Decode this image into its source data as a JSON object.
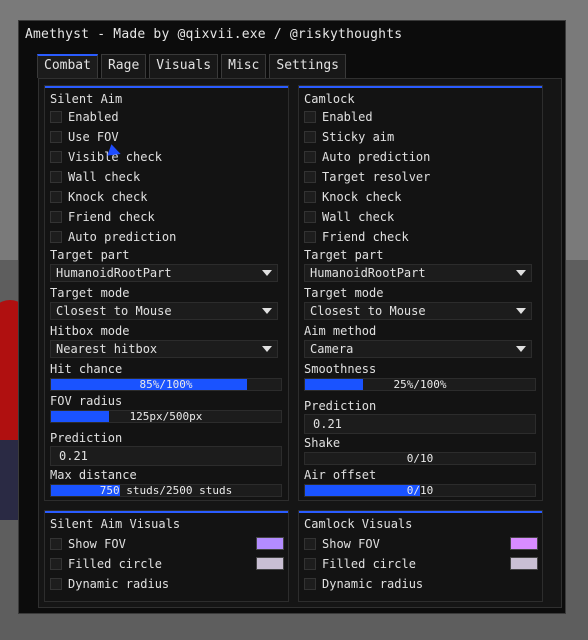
{
  "window": {
    "title": "Amethyst - Made by @qixvii.exe / @riskythoughts"
  },
  "tabs": [
    "Combat",
    "Rage",
    "Visuals",
    "Misc",
    "Settings"
  ],
  "active_tab": "Combat",
  "accent_color": "#2a5cff",
  "silent_aim": {
    "title": "Silent Aim",
    "checkboxes": [
      "Enabled",
      "Use FOV",
      "Visible check",
      "Wall check",
      "Knock check",
      "Friend check",
      "Auto prediction"
    ],
    "target_part": {
      "label": "Target part",
      "value": "HumanoidRootPart"
    },
    "target_mode": {
      "label": "Target mode",
      "value": "Closest to Mouse"
    },
    "hitbox_mode": {
      "label": "Hitbox mode",
      "value": "Nearest hitbox"
    },
    "hit_chance": {
      "label": "Hit chance",
      "text": "85%/100%",
      "fraction": 0.85
    },
    "fov_radius": {
      "label": "FOV radius",
      "text": "125px/500px",
      "fraction": 0.25
    },
    "prediction": {
      "label": "Prediction",
      "value": "0.21"
    },
    "max_distance": {
      "label": "Max distance",
      "text": "750 studs/2500 studs",
      "fraction": 0.3
    }
  },
  "camlock": {
    "title": "Camlock",
    "checkboxes": [
      "Enabled",
      "Sticky aim",
      "Auto prediction",
      "Target resolver",
      "Knock check",
      "Wall check",
      "Friend check"
    ],
    "target_part": {
      "label": "Target part",
      "value": "HumanoidRootPart"
    },
    "target_mode": {
      "label": "Target mode",
      "value": "Closest to Mouse"
    },
    "aim_method": {
      "label": "Aim method",
      "value": "Camera"
    },
    "smoothness": {
      "label": "Smoothness",
      "text": "25%/100%",
      "fraction": 0.25
    },
    "prediction": {
      "label": "Prediction",
      "value": "0.21"
    },
    "shake": {
      "label": "Shake",
      "text": "0/10",
      "fraction": 0.0
    },
    "air_offset": {
      "label": "Air offset",
      "text": "0/10",
      "fraction": 0.5
    }
  },
  "silent_aim_visuals": {
    "title": "Silent Aim Visuals",
    "items": [
      {
        "label": "Show FOV",
        "swatch": "#b38cff"
      },
      {
        "label": "Filled circle",
        "swatch": "#c9bfd3"
      },
      {
        "label": "Dynamic radius"
      }
    ]
  },
  "camlock_visuals": {
    "title": "Camlock Visuals",
    "items": [
      {
        "label": "Show FOV",
        "swatch": "#d88cff"
      },
      {
        "label": "Filled circle",
        "swatch": "#c9bfd3"
      },
      {
        "label": "Dynamic radius"
      }
    ]
  },
  "icons": {
    "cursor": "cursor-icon"
  }
}
